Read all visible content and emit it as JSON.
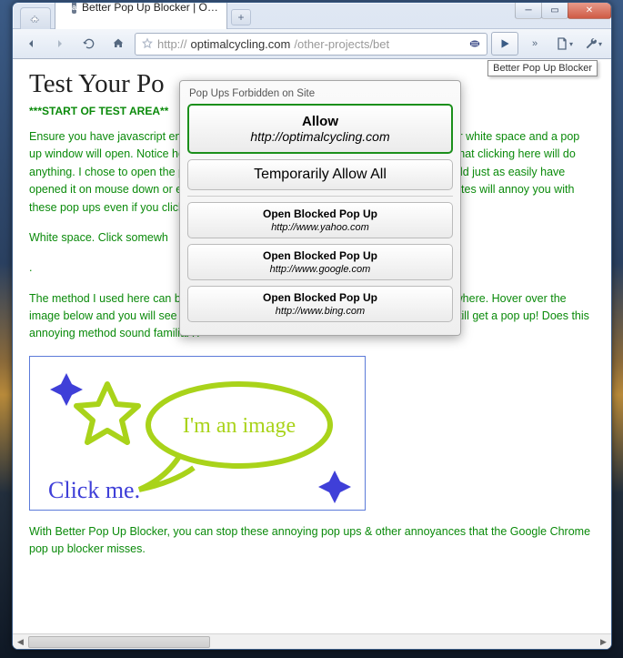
{
  "tabs": {
    "page_title": "Better Pop Up Blocker | O…",
    "page_favicon_letter": "a"
  },
  "toolbar": {
    "url_full": "http://optimalcycling.com/other-projects/bet",
    "url_scheme": "http://",
    "url_host": "optimalcycling.com",
    "url_path": "/other-projects/bet"
  },
  "tooltip": "Better Pop Up Blocker",
  "popup": {
    "header": "Pop Ups Forbidden on Site",
    "allow_label": "Allow",
    "allow_domain": "http://optimalcycling.com",
    "temp_label": "Temporarily Allow All",
    "blocked": [
      {
        "title": "Open Blocked Pop Up",
        "url": "http://www.yahoo.com"
      },
      {
        "title": "Open Blocked Pop Up",
        "url": "http://www.google.com"
      },
      {
        "title": "Open Blocked Pop Up",
        "url": "http://www.bing.com"
      }
    ]
  },
  "page": {
    "heading": "Test Your Po",
    "start_label": "***START OF TEST AREA**",
    "para1": "Ensure you have javascript enabled. Click somewhere on this page – the green text or white space and a pop up window will open. Notice how my mouse did not change. There was no indication that clicking here will do anything. I chose to open the pop up window on mouse up at the same time, but I could just as easily have opened it on mouse down or even mouse move. Frequently, picture, video, or poker sites will annoy you with these pop ups even if you click somewhere, anything, even white space.",
    "para2": "White space. Click somewh",
    "para3": ".",
    "para4": "The method I used here can be applied to images too. Javascript can be applied anywhere. Hover over the image below and you will see that you can't right click on it successfully and you will still get a pop up! Does this annoying method sound familiar?:",
    "image_caption_top": "I'm an image",
    "image_caption_bottom": "Click me.",
    "para5": "With Better Pop Up Blocker, you can stop these annoying pop ups & other annoyances that the Google Chrome pop up blocker misses."
  }
}
